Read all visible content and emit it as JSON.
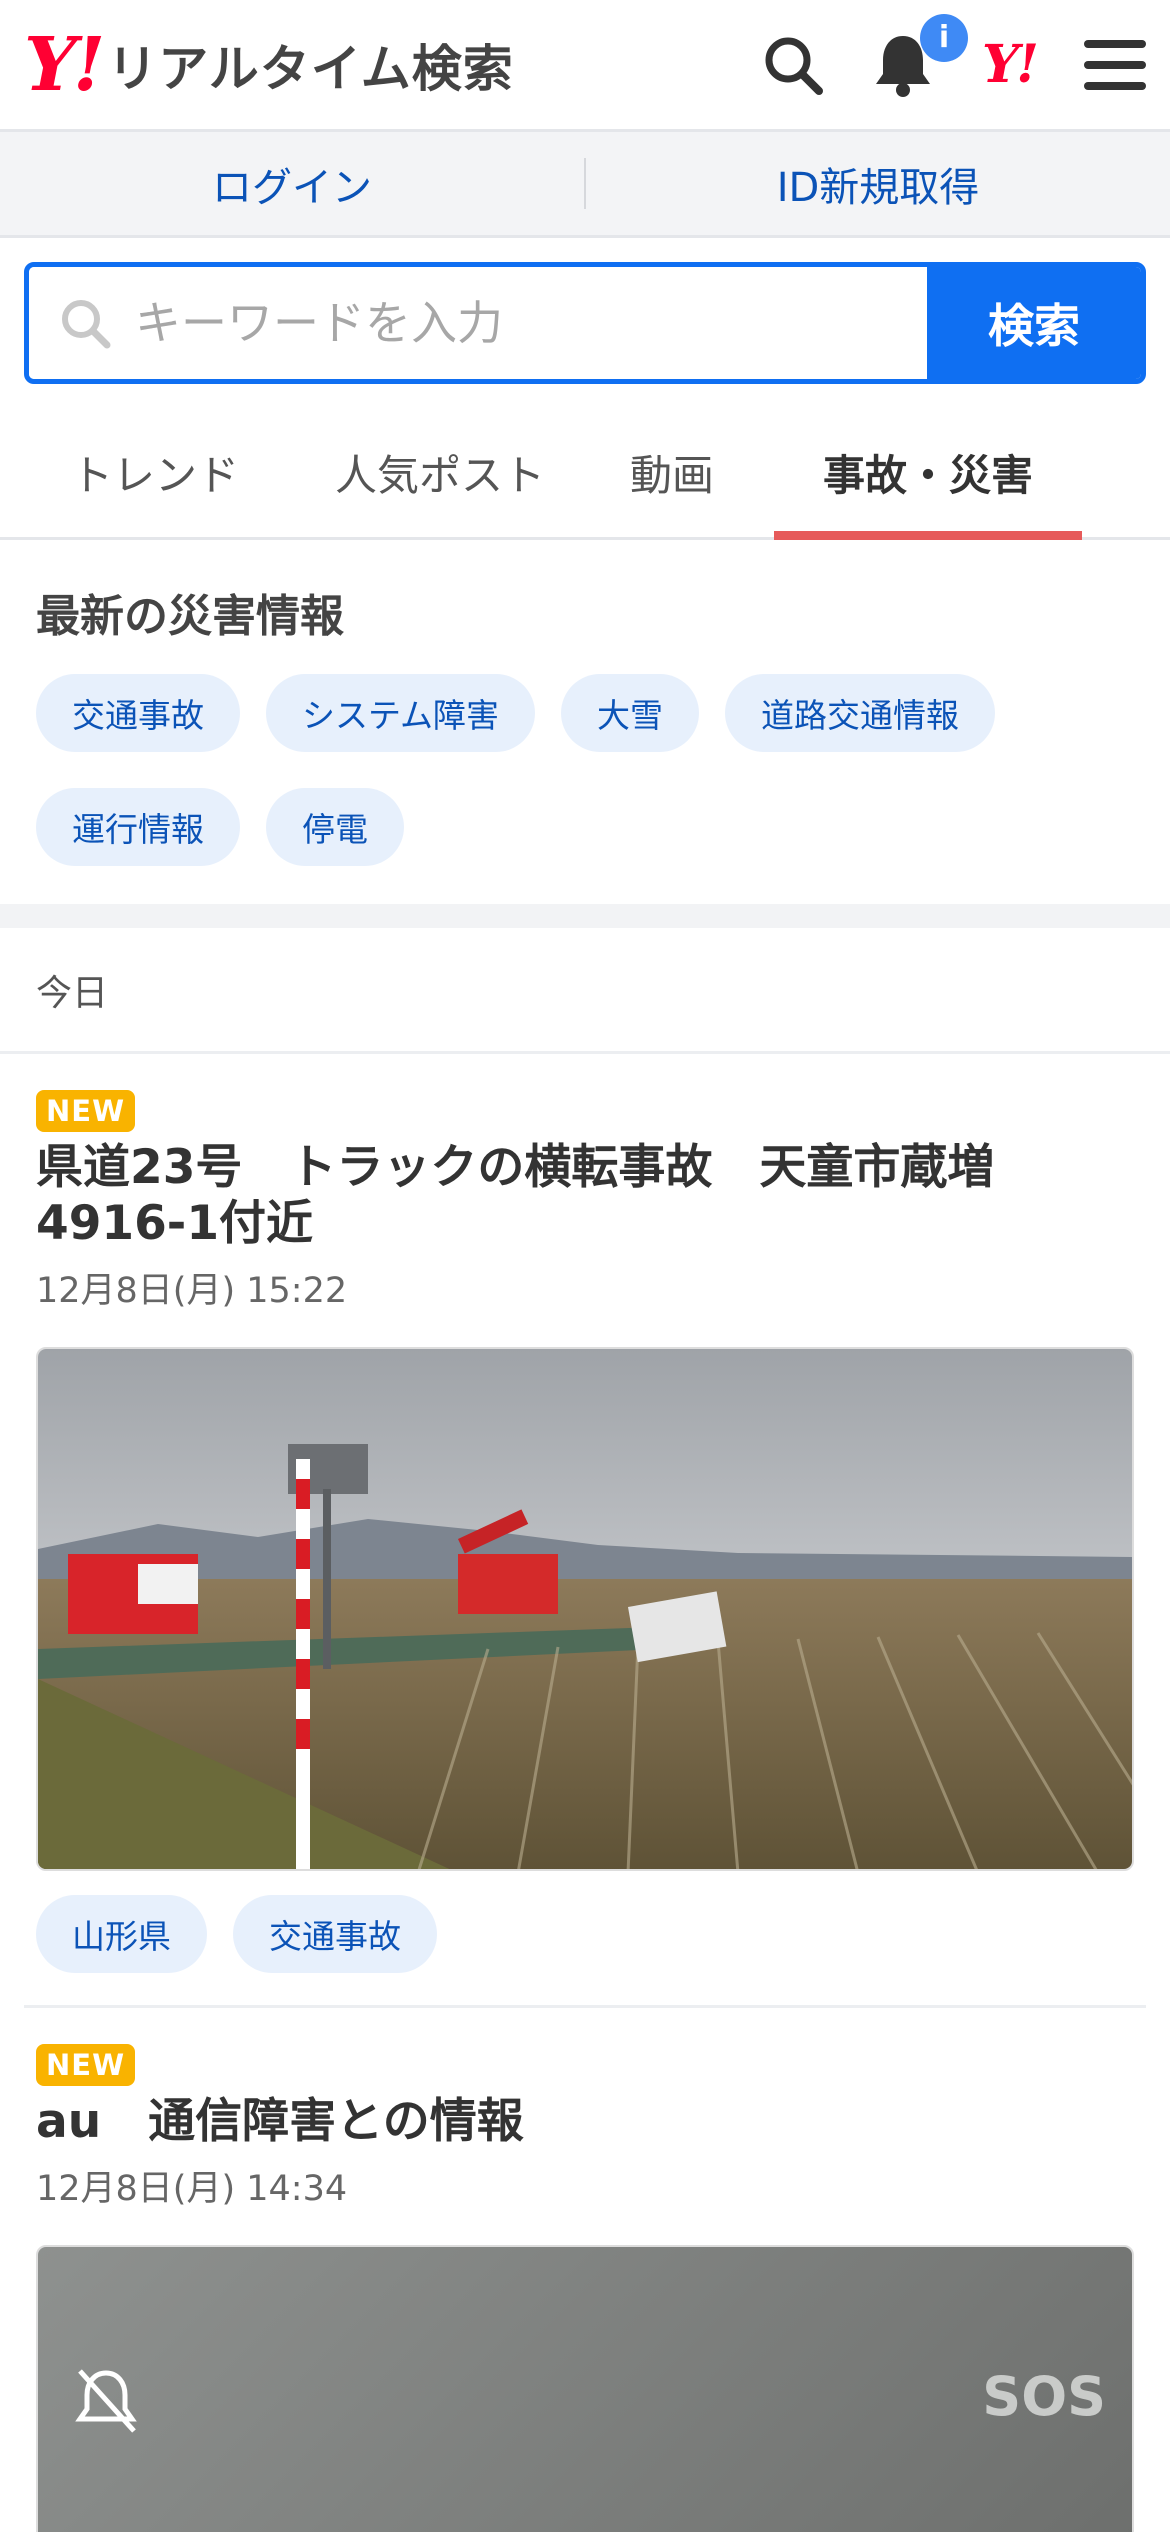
{
  "header": {
    "logo_mark": "Y!",
    "logo_text": "リアルタイム検索",
    "notification_count": "i",
    "yahoo_mark": "Y!"
  },
  "login_bar": {
    "login_label": "ログイン",
    "signup_label": "ID新規取得"
  },
  "search": {
    "placeholder": "キーワードを入力",
    "button_label": "検索"
  },
  "tabs": [
    {
      "label": "トレンド"
    },
    {
      "label": "人気ポスト"
    },
    {
      "label": "動画"
    },
    {
      "label": "事故・災害",
      "active": true
    }
  ],
  "disaster": {
    "title": "最新の災害情報",
    "chips": [
      "交通事故",
      "システム障害",
      "大雪",
      "道路交通情報",
      "運行情報",
      "停電"
    ]
  },
  "feed": {
    "day_label": "今日",
    "articles": [
      {
        "badge": "NEW",
        "title": "県道23号　トラックの横転事故　天童市蔵増4916-1付近",
        "date": "12月8日(月) 15:22",
        "tags": [
          "山形県",
          "交通事故"
        ]
      },
      {
        "badge": "NEW",
        "title": "au　通信障害との情報",
        "date": "12月8日(月) 14:34",
        "overlay_text": "SOS"
      }
    ]
  },
  "colors": {
    "accent": "#0f6ff2",
    "brand_red": "#ff0033",
    "tab_indicator": "#e65a5a",
    "new_badge": "#f9b300"
  }
}
